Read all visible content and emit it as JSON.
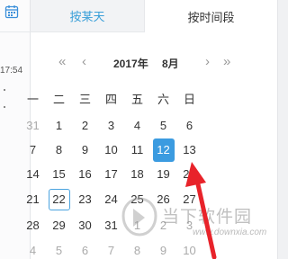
{
  "left_strip": {
    "time_fragment": "17:54"
  },
  "tabs": [
    {
      "label": "按某天",
      "active": true
    },
    {
      "label": "按时间段",
      "active": false
    }
  ],
  "nav": {
    "prev_year": "«",
    "prev_month": "‹",
    "year": "2017年",
    "month": "8月",
    "next_month": "›",
    "next_year": "»"
  },
  "weekdays": [
    "一",
    "二",
    "三",
    "四",
    "五",
    "六",
    "日"
  ],
  "weeks": [
    [
      "31",
      "1",
      "2",
      "3",
      "4",
      "5",
      "6"
    ],
    [
      "7",
      "8",
      "9",
      "10",
      "11",
      "12",
      "13"
    ],
    [
      "14",
      "15",
      "16",
      "17",
      "18",
      "19",
      "20"
    ],
    [
      "21",
      "22",
      "23",
      "24",
      "25",
      "26",
      "27"
    ],
    [
      "28",
      "29",
      "30",
      "31",
      "1",
      "2",
      "3"
    ],
    [
      "4",
      "5",
      "6",
      "7",
      "8",
      "9",
      "10"
    ]
  ],
  "today": "22",
  "selected": "12",
  "colors": {
    "accent": "#3b9be0",
    "arrow": "#e8232a"
  },
  "watermark": {
    "text": "当下软件园",
    "url": "www.downxia.com"
  }
}
